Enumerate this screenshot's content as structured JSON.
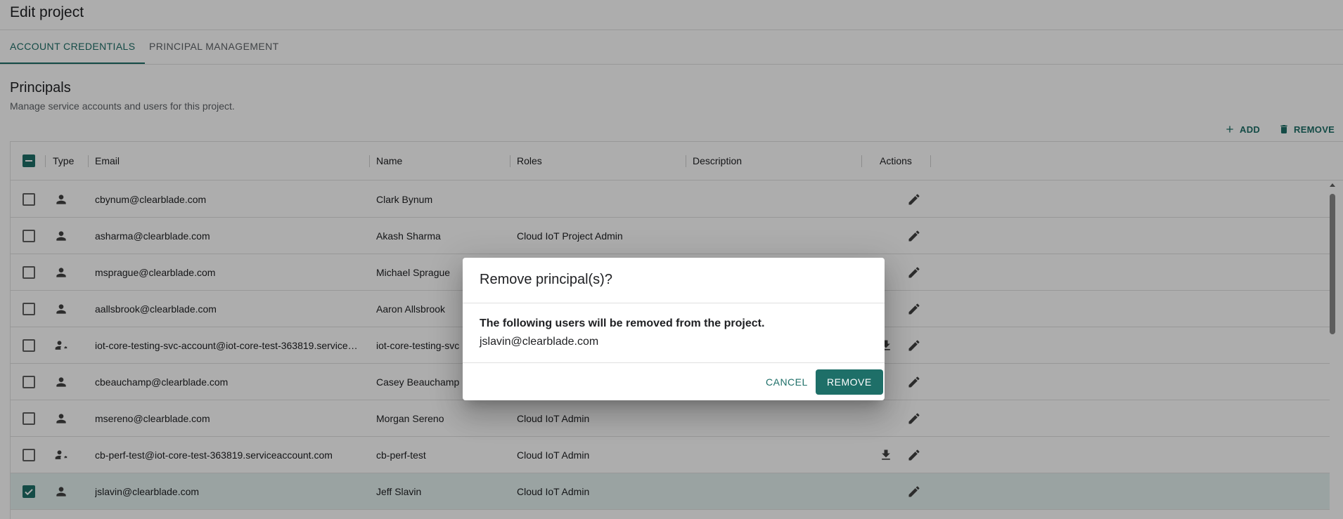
{
  "page": {
    "title": "Edit project"
  },
  "tabs": [
    {
      "label": "ACCOUNT CREDENTIALS",
      "active": true
    },
    {
      "label": "PRINCIPAL MANAGEMENT",
      "active": false
    }
  ],
  "section": {
    "title": "Principals",
    "subtitle": "Manage service accounts and users for this project."
  },
  "toolbar": {
    "add_label": "ADD",
    "remove_label": "REMOVE",
    "add_icon": "plus-icon",
    "remove_icon": "trash-icon"
  },
  "grid": {
    "columns": {
      "type": "Type",
      "email": "Email",
      "name": "Name",
      "roles": "Roles",
      "description": "Description",
      "actions": "Actions"
    },
    "rows": [
      {
        "email": "cbynum@clearblade.com",
        "name": "Clark Bynum",
        "roles": "",
        "description": "",
        "type": "user",
        "selected": false,
        "download": false
      },
      {
        "email": "asharma@clearblade.com",
        "name": "Akash Sharma",
        "roles": "Cloud IoT Project Admin",
        "description": "",
        "type": "user",
        "selected": false,
        "download": false
      },
      {
        "email": "msprague@clearblade.com",
        "name": "Michael Sprague",
        "roles": "",
        "description": "",
        "type": "user",
        "selected": false,
        "download": false
      },
      {
        "email": "aallsbrook@clearblade.com",
        "name": "Aaron Allsbrook",
        "roles": "",
        "description": "",
        "type": "user",
        "selected": false,
        "download": false
      },
      {
        "email": "iot-core-testing-svc-account@iot-core-test-363819.service…",
        "name": "iot-core-testing-svc",
        "roles": "",
        "description": "",
        "type": "service-account",
        "selected": false,
        "download": true
      },
      {
        "email": "cbeauchamp@clearblade.com",
        "name": "Casey Beauchamp",
        "roles": "",
        "description": "",
        "type": "user",
        "selected": false,
        "download": false
      },
      {
        "email": "msereno@clearblade.com",
        "name": "Morgan Sereno",
        "roles": "Cloud IoT Admin",
        "description": "",
        "type": "user",
        "selected": false,
        "download": false
      },
      {
        "email": "cb-perf-test@iot-core-test-363819.serviceaccount.com",
        "name": "cb-perf-test",
        "roles": "Cloud IoT Admin",
        "description": "",
        "type": "service-account",
        "selected": false,
        "download": true
      },
      {
        "email": "jslavin@clearblade.com",
        "name": "Jeff Slavin",
        "roles": "Cloud IoT Admin",
        "description": "",
        "type": "user",
        "selected": true,
        "download": false
      }
    ]
  },
  "dialog": {
    "title": "Remove principal(s)?",
    "message": "The following users will be removed from the project.",
    "email": "jslavin@clearblade.com",
    "cancel_label": "CANCEL",
    "confirm_label": "REMOVE"
  },
  "colors": {
    "accent": "#1e6f68",
    "selected_row": "#e3f0ef"
  }
}
